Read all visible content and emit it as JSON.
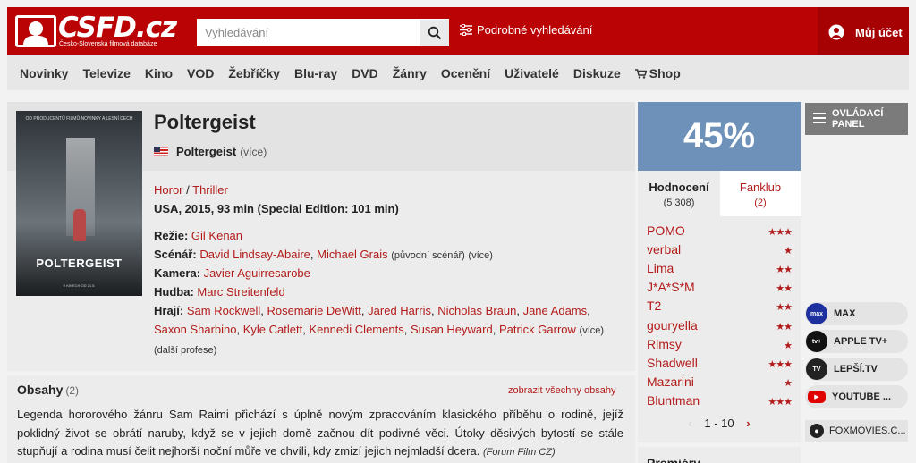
{
  "header": {
    "logo_text": "CSFD.cz",
    "logo_subtitle": "Česko-Slovenská filmová databáze",
    "search_placeholder": "Vyhledávání",
    "advanced_search": "Podrobné vyhledávání",
    "account": "Můj účet"
  },
  "nav": {
    "items": [
      "Novinky",
      "Televize",
      "Kino",
      "VOD",
      "Žebříčky",
      "Blu-ray",
      "DVD",
      "Žánry",
      "Ocenění",
      "Uživatelé",
      "Diskuze",
      "Shop"
    ]
  },
  "film": {
    "title": "Poltergeist",
    "alt_title": "Poltergeist",
    "alt_more": "(více)",
    "genre_1": "Horor",
    "genre_sep": " / ",
    "genre_2": "Thriller",
    "origin": "USA, 2015, 93 min (Special Edition: 101 min)",
    "director_label": "Režie:",
    "director": "Gil Kenan",
    "writer_label": "Scénář:",
    "writer_1": "David Lindsay-Abaire",
    "writer_2": "Michael Grais",
    "writer_note": "(původní scénář)",
    "writer_more": "(více)",
    "camera_label": "Kamera:",
    "camera": "Javier Aguirresarobe",
    "music_label": "Hudba:",
    "music": "Marc Streitenfeld",
    "cast_label": "Hrají:",
    "cast": [
      "Sam Rockwell",
      "Rosemarie DeWitt",
      "Jared Harris",
      "Nicholas Braun",
      "Jane Adams",
      "Saxon Sharbino",
      "Kyle Catlett",
      "Kennedi Clements",
      "Susan Heyward",
      "Patrick Garrow"
    ],
    "cast_more": "(více)",
    "more_professions": "další profese",
    "poster_top": "OD PRODUCENTŮ FILMŮ NOVINKY A LESNÍ DECH",
    "poster_title": "POLTERGEIST",
    "poster_bottom": "V KINECH OD 21.5."
  },
  "plot": {
    "title": "Obsahy",
    "count": "(2)",
    "show_all": "zobrazit všechny obsahy",
    "text": "Legenda hororového žánru Sam Raimi přichází s úplně novým zpracováním klasického příběhu o rodině, jejíž poklidný život se obrátí naruby, když se v jejich domě začnou dít podivné věci. Útoky děsivých bytostí se stále stupňují a rodina musí čelit nejhorší noční můře ve chvíli, kdy zmizí jejich nejmladší dcera.",
    "source": "(Forum Film CZ)"
  },
  "rating": {
    "value": "45%",
    "tab_ratings": "Hodnocení",
    "tab_ratings_count": "(5 308)",
    "tab_fanclub": "Fanklub",
    "tab_fanclub_count": "(2)",
    "users": [
      {
        "name": "POMO",
        "stars": "★★★"
      },
      {
        "name": "verbal",
        "stars": "★"
      },
      {
        "name": "Lima",
        "stars": "★★"
      },
      {
        "name": "J*A*S*M",
        "stars": "★★"
      },
      {
        "name": "T2",
        "stars": "★★"
      },
      {
        "name": "gouryella",
        "stars": "★★"
      },
      {
        "name": "Rimsy",
        "stars": "★"
      },
      {
        "name": "Shadwell",
        "stars": "★★★"
      },
      {
        "name": "Mazarini",
        "stars": "★"
      },
      {
        "name": "Bluntman",
        "stars": "★★★"
      }
    ],
    "pager": "1 - 10",
    "bottom_heading": "Premiéry"
  },
  "sidebar": {
    "control_panel": "OVLÁDACÍ PANEL",
    "streams": [
      {
        "name": "MAX",
        "icon": "max",
        "color": "#1e2f9e"
      },
      {
        "name": "APPLE TV+",
        "icon": "tv+",
        "color": "#111111"
      },
      {
        "name": "LEPŠÍ.TV",
        "icon": "TV",
        "color": "#222222"
      },
      {
        "name": "YOUTUBE ...",
        "icon": "▶",
        "color": "#e00000"
      }
    ],
    "fox": "FOXMOVIES.C..."
  },
  "colors": {
    "brand_red": "#ba0305",
    "rating_blue": "#6d91b8",
    "link_red": "#b31b1b"
  }
}
